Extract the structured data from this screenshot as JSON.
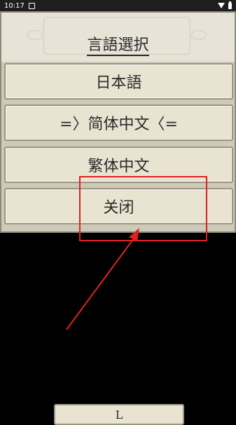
{
  "status_bar": {
    "time": "10:17",
    "notification_icon": "notification-icon",
    "wifi_icon": "wifi-icon",
    "battery_icon": "battery-icon"
  },
  "dialog": {
    "title": "言語選択",
    "options": [
      {
        "label": "日本語"
      },
      {
        "label": "=〉简体中文〈="
      },
      {
        "label": "繁体中文"
      },
      {
        "label": "关闭"
      }
    ]
  },
  "annotation": {
    "color": "#e02020"
  },
  "bottom_button": {
    "label": "L"
  }
}
